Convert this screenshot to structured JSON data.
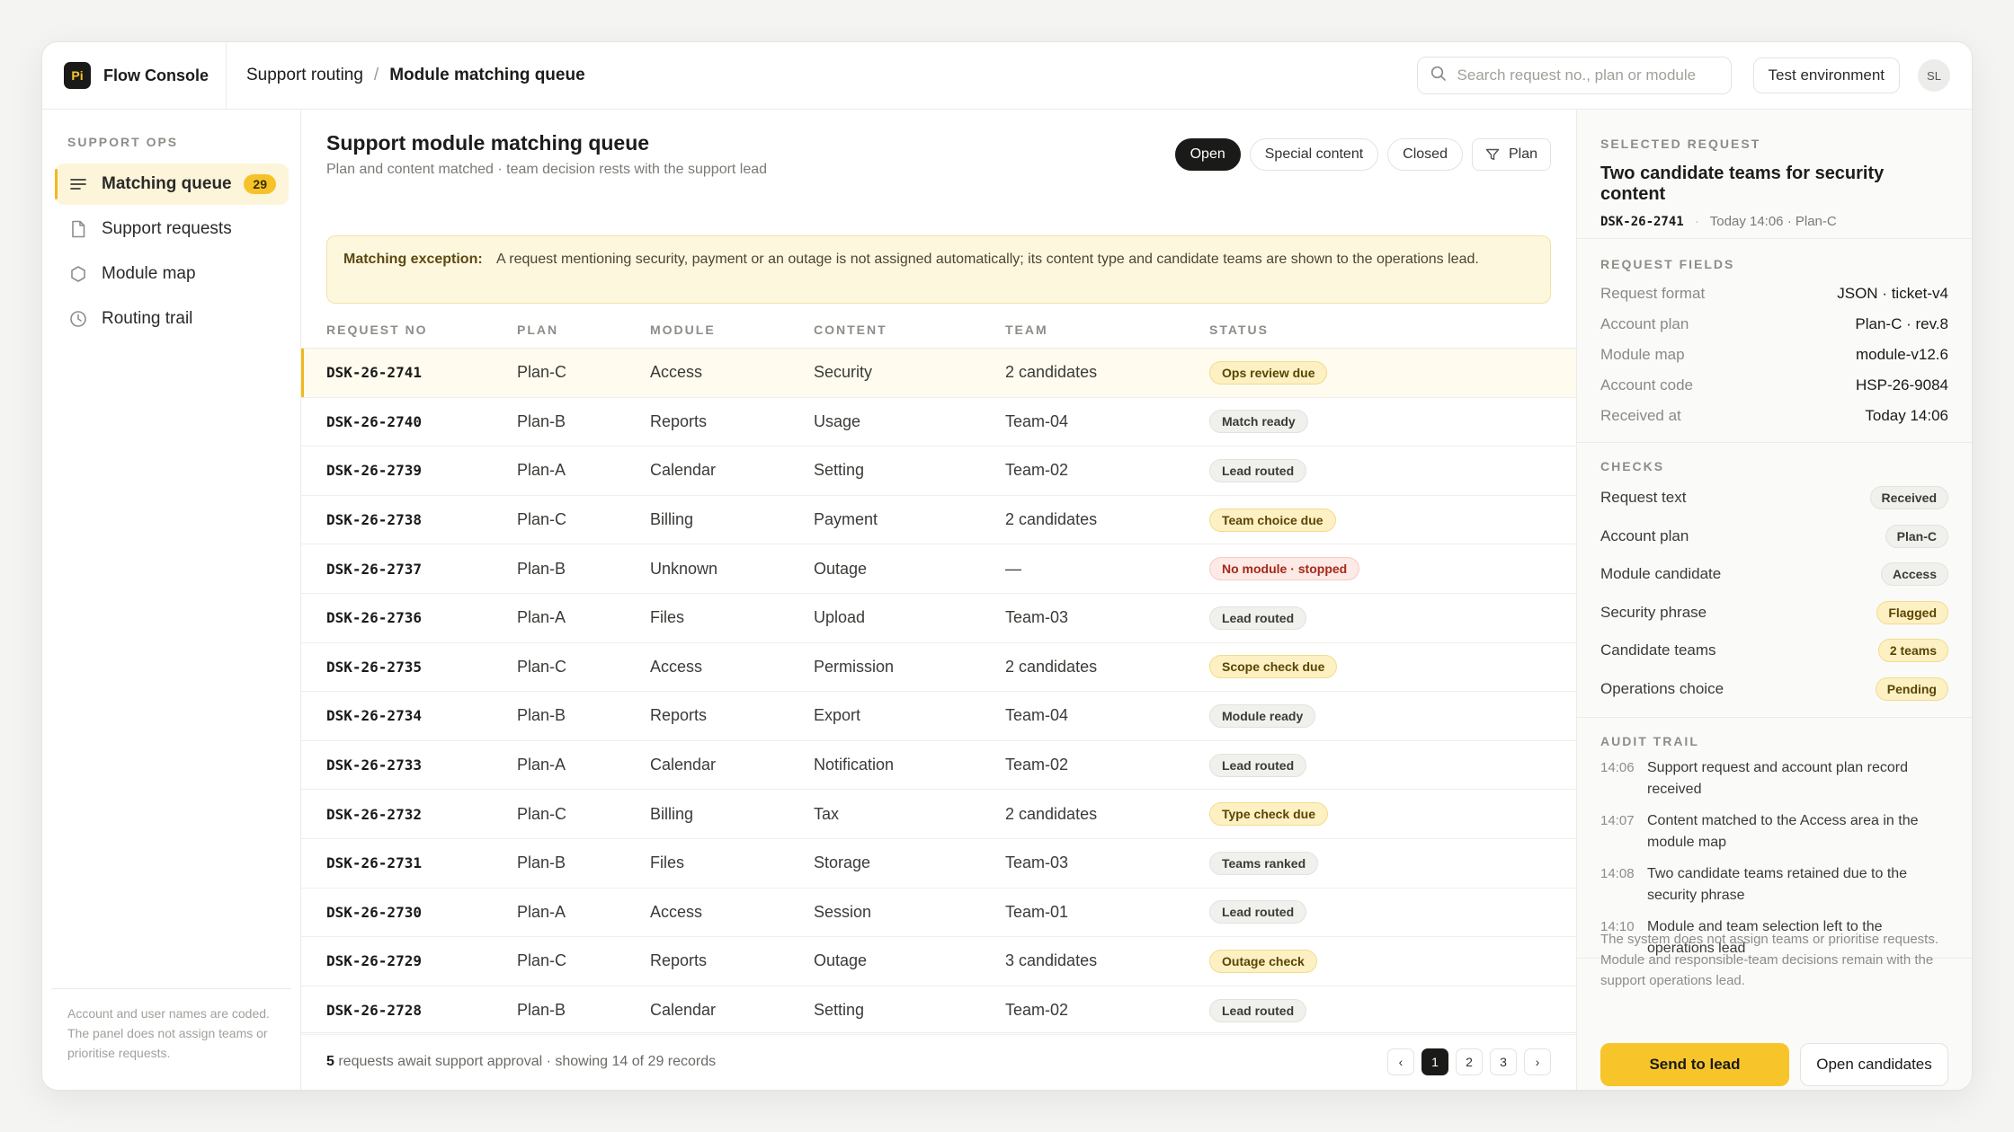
{
  "brand": {
    "logo_text": "Pi",
    "name": "Flow Console"
  },
  "breadcrumb": {
    "parent": "Support routing",
    "separator": "/",
    "current": "Module matching queue"
  },
  "search": {
    "placeholder": "Search request no., plan or module"
  },
  "env_button": "Test environment",
  "avatar": "SL",
  "sidebar": {
    "section": "SUPPORT OPS",
    "items": [
      {
        "label": "Matching queue",
        "icon": "list-icon",
        "badge": "29",
        "active": true
      },
      {
        "label": "Support requests",
        "icon": "document-icon"
      },
      {
        "label": "Module map",
        "icon": "hexagon-icon"
      },
      {
        "label": "Routing trail",
        "icon": "clock-icon"
      }
    ],
    "footnote": "Account and user names are coded. The panel does not assign teams or prioritise requests."
  },
  "main": {
    "title": "Support module matching queue",
    "subtitle": "Plan and content matched · team decision rests with the support lead",
    "filters": [
      "Open",
      "Special content",
      "Closed"
    ],
    "filter_button": "Plan",
    "callout": {
      "label": "Matching exception:",
      "text": "A request mentioning security, payment or an outage is not assigned automatically; its content type and candidate teams are shown to the operations lead."
    },
    "columns": [
      "REQUEST NO",
      "PLAN",
      "MODULE",
      "CONTENT",
      "TEAM",
      "STATUS"
    ],
    "rows": [
      {
        "no": "DSK-26-2741",
        "plan": "Plan-C",
        "module": "Access",
        "content": "Security",
        "team": "2 candidates",
        "status": "Ops review due",
        "tone": "warn"
      },
      {
        "no": "DSK-26-2740",
        "plan": "Plan-B",
        "module": "Reports",
        "content": "Usage",
        "team": "Team-04",
        "status": "Match ready",
        "tone": "neutral"
      },
      {
        "no": "DSK-26-2739",
        "plan": "Plan-A",
        "module": "Calendar",
        "content": "Setting",
        "team": "Team-02",
        "status": "Lead routed",
        "tone": "neutral"
      },
      {
        "no": "DSK-26-2738",
        "plan": "Plan-C",
        "module": "Billing",
        "content": "Payment",
        "team": "2 candidates",
        "status": "Team choice due",
        "tone": "warn"
      },
      {
        "no": "DSK-26-2737",
        "plan": "Plan-B",
        "module": "Unknown",
        "content": "Outage",
        "team": "—",
        "status": "No module · stopped",
        "tone": "danger"
      },
      {
        "no": "DSK-26-2736",
        "plan": "Plan-A",
        "module": "Files",
        "content": "Upload",
        "team": "Team-03",
        "status": "Lead routed",
        "tone": "neutral"
      },
      {
        "no": "DSK-26-2735",
        "plan": "Plan-C",
        "module": "Access",
        "content": "Permission",
        "team": "2 candidates",
        "status": "Scope check due",
        "tone": "warn"
      },
      {
        "no": "DSK-26-2734",
        "plan": "Plan-B",
        "module": "Reports",
        "content": "Export",
        "team": "Team-04",
        "status": "Module ready",
        "tone": "neutral"
      },
      {
        "no": "DSK-26-2733",
        "plan": "Plan-A",
        "module": "Calendar",
        "content": "Notification",
        "team": "Team-02",
        "status": "Lead routed",
        "tone": "neutral"
      },
      {
        "no": "DSK-26-2732",
        "plan": "Plan-C",
        "module": "Billing",
        "content": "Tax",
        "team": "2 candidates",
        "status": "Type check due",
        "tone": "warn"
      },
      {
        "no": "DSK-26-2731",
        "plan": "Plan-B",
        "module": "Files",
        "content": "Storage",
        "team": "Team-03",
        "status": "Teams ranked",
        "tone": "neutral"
      },
      {
        "no": "DSK-26-2730",
        "plan": "Plan-A",
        "module": "Access",
        "content": "Session",
        "team": "Team-01",
        "status": "Lead routed",
        "tone": "neutral"
      },
      {
        "no": "DSK-26-2729",
        "plan": "Plan-C",
        "module": "Reports",
        "content": "Outage",
        "team": "3 candidates",
        "status": "Outage check",
        "tone": "warn"
      },
      {
        "no": "DSK-26-2728",
        "plan": "Plan-B",
        "module": "Calendar",
        "content": "Setting",
        "team": "Team-02",
        "status": "Lead routed",
        "tone": "neutral"
      }
    ],
    "footer": {
      "count": "5",
      "text": " requests await support approval · showing 14 of 29 records"
    },
    "pager": {
      "prev": "‹",
      "pages": [
        "1",
        "2",
        "3"
      ],
      "next": "›"
    }
  },
  "panel": {
    "label": "SELECTED REQUEST",
    "title": "Two candidate teams for security content",
    "meta_id": "DSK-26-2741",
    "meta_rest": "Today 14:06 · Plan-C",
    "fields_label": "REQUEST FIELDS",
    "fields": [
      {
        "k": "Request format",
        "v": "JSON · ticket-v4"
      },
      {
        "k": "Account plan",
        "v": "Plan-C · rev.8"
      },
      {
        "k": "Module map",
        "v": "module-v12.6"
      },
      {
        "k": "Account code",
        "v": "HSP-26-9084"
      },
      {
        "k": "Received at",
        "v": "Today 14:06"
      }
    ],
    "checks_label": "CHECKS",
    "checks": [
      {
        "k": "Request text",
        "v": "Received",
        "tone": "neutral"
      },
      {
        "k": "Account plan",
        "v": "Plan-C",
        "tone": "neutral"
      },
      {
        "k": "Module candidate",
        "v": "Access",
        "tone": "neutral"
      },
      {
        "k": "Security phrase",
        "v": "Flagged",
        "tone": "warn"
      },
      {
        "k": "Candidate teams",
        "v": "2 teams",
        "tone": "warn"
      },
      {
        "k": "Operations choice",
        "v": "Pending",
        "tone": "warn"
      }
    ],
    "audit_label": "AUDIT TRAIL",
    "audit": [
      {
        "t": "14:06",
        "text": "Support request and account plan record received"
      },
      {
        "t": "14:07",
        "text": "Content matched to the Access area in the module map"
      },
      {
        "t": "14:08",
        "text": "Two candidate teams retained due to the security phrase"
      },
      {
        "t": "14:10",
        "text": "Module and team selection left to the operations lead"
      }
    ],
    "footnote": "The system does not assign teams or prioritise requests. Module and responsible-team decisions remain with the support operations lead.",
    "primary_button": "Send to lead",
    "secondary_button": "Open candidates"
  }
}
